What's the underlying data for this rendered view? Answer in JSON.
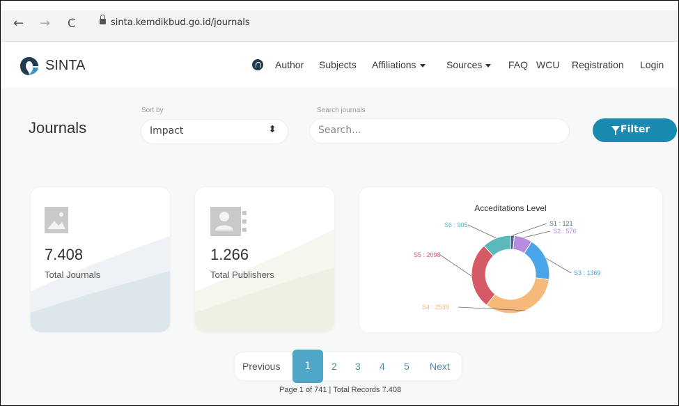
{
  "browser": {
    "url": "sinta.kemdikbud.go.id/journals"
  },
  "header": {
    "brand": "SINTA",
    "nav": [
      "Author",
      "Subjects",
      "Affiliations",
      "Sources",
      "FAQ",
      "WCU",
      "Registration",
      "Login"
    ]
  },
  "filters": {
    "title": "Journals",
    "sort_label": "Sort by",
    "sort_value": "Impact",
    "search_label": "Search journals",
    "search_placeholder": "Search...",
    "filter_button": "Filter"
  },
  "stats": {
    "total_journals_value": "7.408",
    "total_journals_label": "Total Journals",
    "total_publishers_value": "1.266",
    "total_publishers_label": "Total Publishers"
  },
  "chart_data": {
    "type": "pie",
    "title": "Acceditations Level",
    "donut": true,
    "labels": [
      "S1 : 121",
      "S2 : 576",
      "S3 : 1369",
      "S4 : 2539",
      "S5 : 2098",
      "S6 : 905"
    ],
    "values": [
      121,
      576,
      1369,
      2539,
      2098,
      905
    ],
    "colors": [
      "#4c6a84",
      "#b68be0",
      "#4aa5e8",
      "#f7b97a",
      "#d55a67",
      "#5ab9ba"
    ]
  },
  "pagination": {
    "previous": "Previous",
    "pages": [
      "1",
      "2",
      "3",
      "4",
      "5"
    ],
    "active_page": "1",
    "next": "Next",
    "info": "Page 1 of 741 | Total Records 7.408"
  }
}
